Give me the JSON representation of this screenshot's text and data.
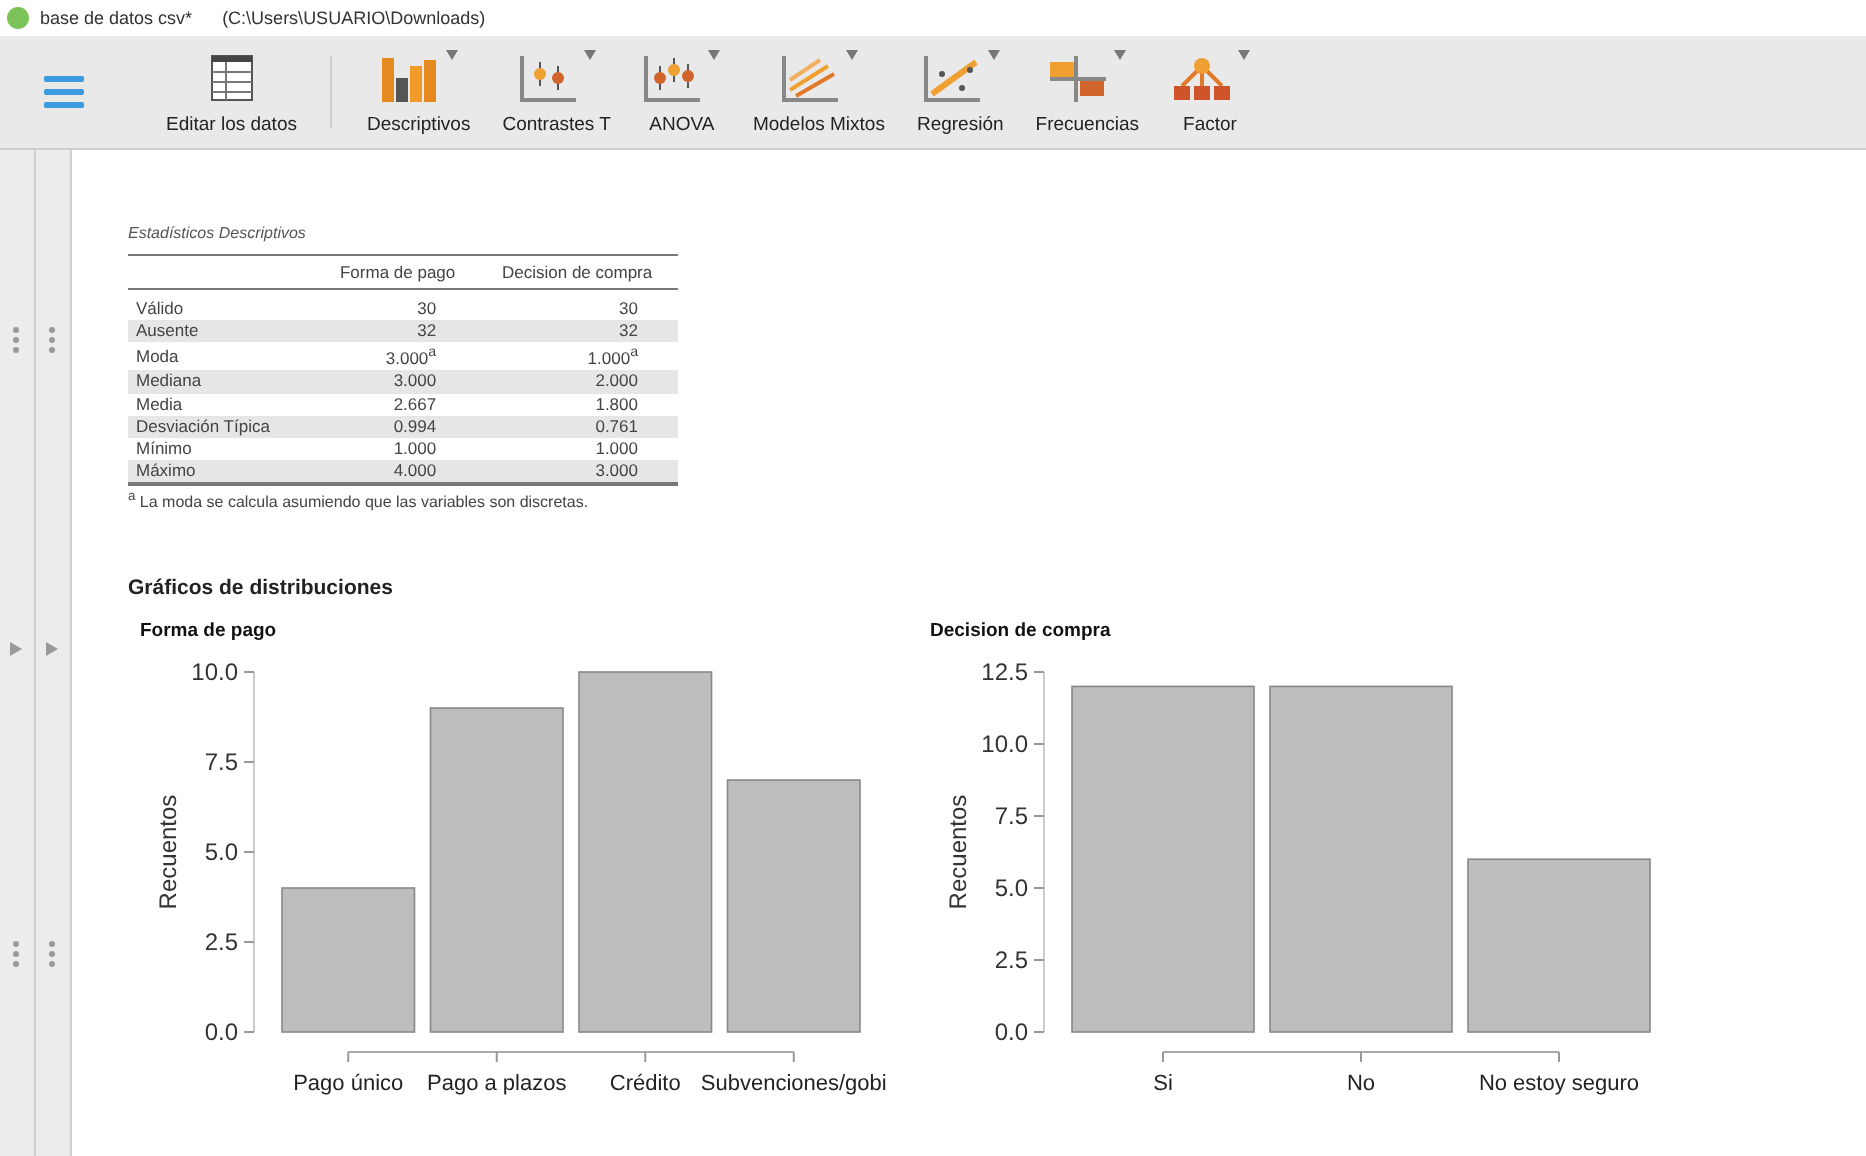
{
  "title_bar": {
    "file": "base de datos csv*",
    "path": "(C:\\Users\\USUARIO\\Downloads)"
  },
  "toolbar": {
    "groups": [
      [
        {
          "label": "Editar los datos",
          "dropdown": false
        }
      ],
      [
        {
          "label": "Descriptivos",
          "dropdown": true
        },
        {
          "label": "Contrastes T",
          "dropdown": true
        },
        {
          "label": "ANOVA",
          "dropdown": true
        },
        {
          "label": "Modelos Mixtos",
          "dropdown": true
        },
        {
          "label": "Regresión",
          "dropdown": true
        },
        {
          "label": "Frecuencias",
          "dropdown": true
        },
        {
          "label": "Factor",
          "dropdown": true
        }
      ]
    ]
  },
  "results": {
    "table": {
      "title": "Estadísticos Descriptivos",
      "columns": [
        "Forma de pago",
        "Decision de compra"
      ],
      "rows": [
        {
          "label": "Válido",
          "values": [
            "30",
            "30"
          ]
        },
        {
          "label": "Ausente",
          "values": [
            "32",
            "32"
          ]
        },
        {
          "label": "Moda",
          "values": [
            "3.000$^{a}$",
            "1.000$^{a}$"
          ]
        },
        {
          "label": "Mediana",
          "values": [
            "3.000",
            "2.000"
          ]
        },
        {
          "label": "Media",
          "values": [
            "2.667",
            "1.800"
          ]
        },
        {
          "label": "Desviación Típica",
          "values": [
            "0.994",
            "0.761"
          ]
        },
        {
          "label": "Mínimo",
          "values": [
            "1.000",
            "1.000"
          ]
        },
        {
          "label": "Máximo",
          "values": [
            "4.000",
            "3.000"
          ]
        }
      ],
      "footnote": "$^{a}$ La moda se calcula asumiendo que las variables son discretas."
    },
    "section_title": "Gráficos de distribuciones",
    "charts": [
      {
        "chart_data": {
          "type": "bar",
          "title": "Forma de pago",
          "ylabel": "Recuentos",
          "categories": [
            "Pago único",
            "Pago a plazos",
            "Crédito",
            "Subvenciones/gobi"
          ],
          "values": [
            4,
            9,
            10,
            7
          ],
          "ylim": [
            0,
            10
          ],
          "yticks": [
            {
              "value": 0,
              "label": "0.0"
            },
            {
              "value": 2.5,
              "label": "2.5"
            },
            {
              "value": 5,
              "label": "5.0"
            },
            {
              "value": 7.5,
              "label": "7.5"
            },
            {
              "value": 10,
              "label": "10.0"
            }
          ]
        }
      },
      {
        "chart_data": {
          "type": "bar",
          "title": "Decision de compra",
          "ylabel": "Recuentos",
          "categories": [
            "Si",
            "No",
            "No estoy seguro"
          ],
          "values": [
            12,
            12,
            6
          ],
          "ylim": [
            0,
            12.5
          ],
          "yticks": [
            {
              "value": 0,
              "label": "0.0"
            },
            {
              "value": 2.5,
              "label": "2.5"
            },
            {
              "value": 5,
              "label": "5.0"
            },
            {
              "value": 7.5,
              "label": "7.5"
            },
            {
              "value": 10,
              "label": "10.0"
            },
            {
              "value": 12.5,
              "label": "12.5"
            }
          ]
        }
      }
    ]
  }
}
